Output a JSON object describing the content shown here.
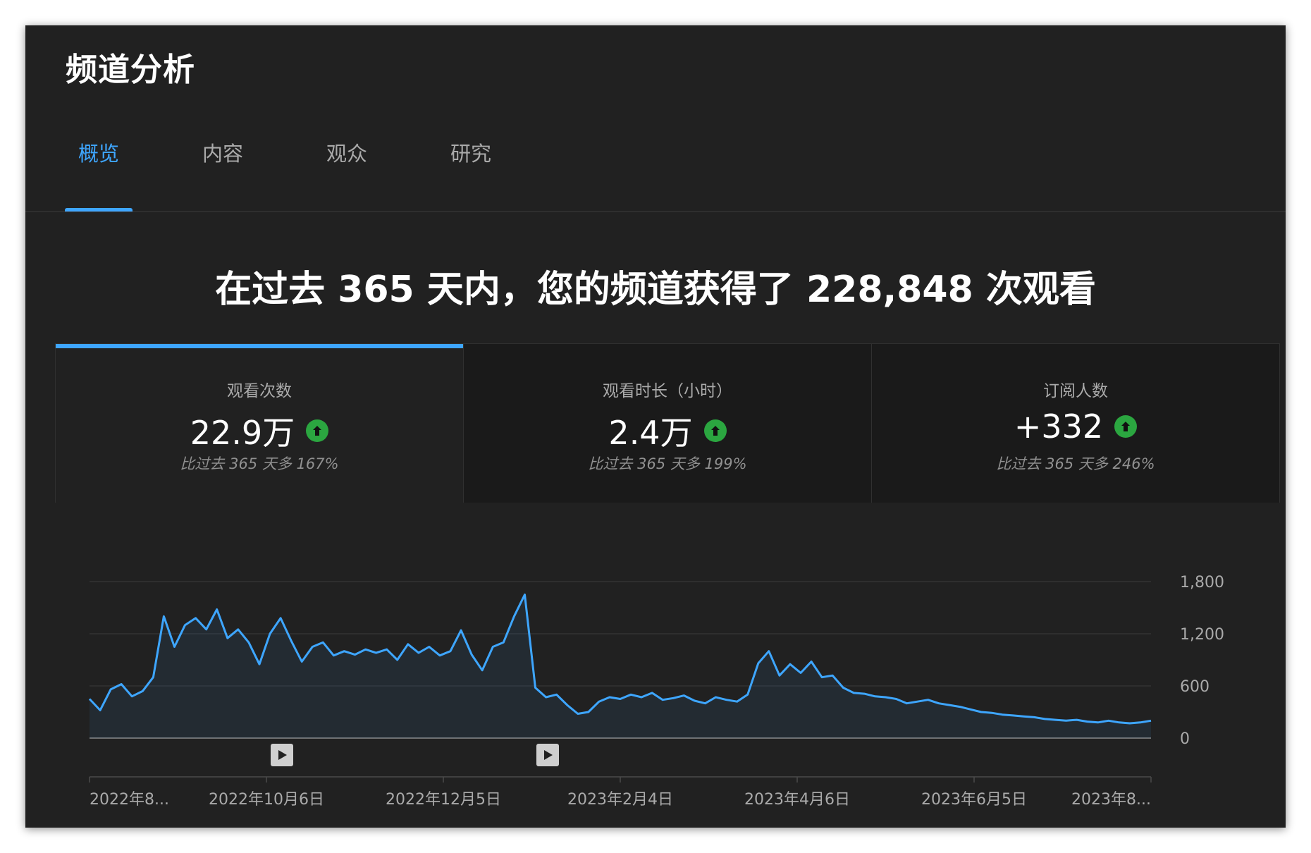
{
  "page_title": "频道分析",
  "tabs": [
    {
      "label": "概览",
      "active": true
    },
    {
      "label": "内容",
      "active": false
    },
    {
      "label": "观众",
      "active": false
    },
    {
      "label": "研究",
      "active": false
    }
  ],
  "headline": "在过去 365 天内，您的频道获得了 228,848 次观看",
  "cards": [
    {
      "label": "观看次数",
      "value": "22.9万",
      "compare": "比过去 365 天多 167%",
      "trend_icon": "arrow-up-icon",
      "active": true
    },
    {
      "label": "观看时长（小时）",
      "value": "2.4万",
      "compare": "比过去 365 天多 199%",
      "trend_icon": "arrow-up-icon",
      "active": false
    },
    {
      "label": "订阅人数",
      "value": "+332",
      "compare": "比过去 365 天多 246%",
      "trend_icon": "arrow-up-icon",
      "active": false
    }
  ],
  "colors": {
    "accent": "#3ea6ff",
    "line": "#3ea6ff",
    "up": "#2ba640",
    "background": "#212121"
  },
  "chart_data": {
    "type": "line",
    "series": [
      {
        "values": [
          450,
          320,
          560,
          620,
          480,
          540,
          700,
          1400,
          1050,
          1300,
          1380,
          1250,
          1480,
          1150,
          1250,
          1100,
          850,
          1200,
          1380,
          1120,
          880,
          1050,
          1100,
          950,
          1000,
          960,
          1020,
          980,
          1020,
          900,
          1080,
          980,
          1050,
          950,
          1000,
          1240,
          960,
          780,
          1050,
          1100,
          1400,
          1650,
          580,
          470,
          500,
          380,
          280,
          300,
          420,
          470,
          450,
          500,
          470,
          520,
          440,
          460,
          490,
          430,
          400,
          470,
          440,
          420,
          500,
          860,
          1000,
          720,
          850,
          750,
          880,
          700,
          720,
          580,
          520,
          510,
          480,
          470,
          450,
          400,
          420,
          440,
          400,
          380,
          360,
          330,
          300,
          290,
          270,
          260,
          250,
          240,
          220,
          210,
          200,
          210,
          190,
          180,
          200,
          180,
          170,
          180,
          200
        ]
      }
    ],
    "x_tick_labels": [
      "2022年8...",
      "2022年10月6日",
      "2022年12月5日",
      "2023年2月4日",
      "2023年4月6日",
      "2023年6月5日",
      "2023年8..."
    ],
    "y_tick_labels": [
      "0",
      "600",
      "1,200",
      "1,800"
    ],
    "ylim": [
      0,
      1800
    ],
    "grid": true,
    "play_markers": [
      2,
      5
    ]
  }
}
